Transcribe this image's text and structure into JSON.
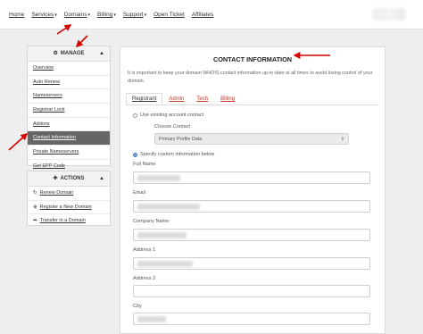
{
  "nav": {
    "items": [
      {
        "label": "Home",
        "dropdown": false
      },
      {
        "label": "Services",
        "dropdown": true
      },
      {
        "label": "Domains",
        "dropdown": true
      },
      {
        "label": "Billing",
        "dropdown": true
      },
      {
        "label": "Support",
        "dropdown": true
      },
      {
        "label": "Open Ticket",
        "dropdown": false
      },
      {
        "label": "Affiliates",
        "dropdown": false
      }
    ],
    "caret": "▾"
  },
  "manage": {
    "title": "MANAGE",
    "collapse": "▲",
    "items": [
      "Overview",
      "Auto Renew",
      "Nameservers",
      "Registrar Lock",
      "Addons",
      "Contact Information",
      "Private Nameservers",
      "Get EPP Code"
    ],
    "active_index": 5
  },
  "actions": {
    "title": "ACTIONS",
    "collapse": "▲",
    "items": [
      {
        "label": "Renew Domain",
        "icon": "refresh-icon"
      },
      {
        "label": "Register a New Domain",
        "icon": "globe-icon"
      },
      {
        "label": "Transfer in a Domain",
        "icon": "transfer-icon"
      }
    ]
  },
  "main": {
    "title": "CONTACT INFORMATION",
    "description": "It is important to keep your domain WHOIS contact information up-to-date at all times to avoid losing control of your domain.",
    "tabs": [
      "Registrant",
      "Admin",
      "Tech",
      "Billing"
    ],
    "active_tab": 0,
    "use_existing_label": "Use existing account contact",
    "choose_contact_label": "Choose Contact",
    "choose_contact_value": "Primary Profile Data",
    "specify_custom_label": "Specify custom information below",
    "fields": [
      "Full Name",
      "Email",
      "Company Name",
      "Address 1",
      "Address 2",
      "City"
    ]
  },
  "colors": {
    "accent_red": "#c0392b",
    "active_menu": "#666666",
    "annotation_arrow": "#d40000"
  }
}
